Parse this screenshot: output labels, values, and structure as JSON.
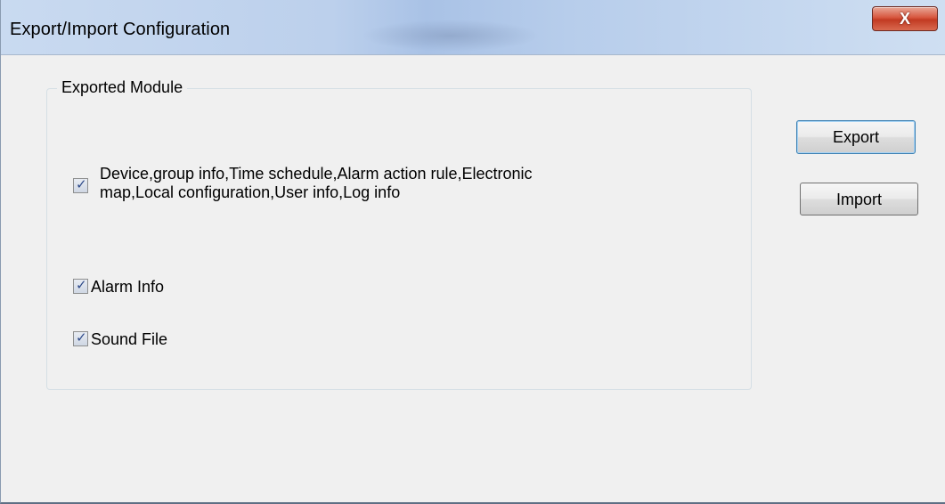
{
  "window": {
    "title": "Export/Import Configuration",
    "close_label": "X"
  },
  "group": {
    "legend": "Exported Module",
    "options": [
      {
        "label_line1": "Device,group info,Time schedule,Alarm action rule,Electronic",
        "label_line2": "map,Local configuration,User info,Log info",
        "checked": true
      },
      {
        "label": "Alarm Info",
        "checked": true
      },
      {
        "label": "Sound File",
        "checked": true
      }
    ]
  },
  "buttons": {
    "export_label": "Export",
    "import_label": "Import"
  },
  "colors": {
    "titlebar": "#bcd0ec",
    "window_bg": "#f0f0f0",
    "close_red": "#c23a22",
    "check_mark": "#2f4b8a"
  },
  "icons": {
    "checkmark": "check-icon",
    "close": "close-icon"
  }
}
